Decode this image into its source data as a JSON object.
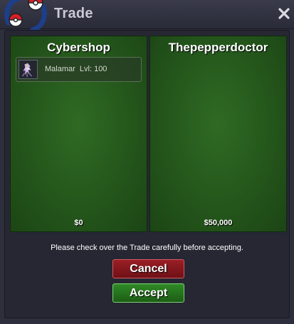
{
  "window": {
    "title": "Trade",
    "logo_icon": "pokeball-badge-icon",
    "close_icon": "close-x-icon"
  },
  "left_panel": {
    "player_name": "Cybershop",
    "money": "$0",
    "items": [
      {
        "icon": "malamar-sprite-icon",
        "label": "Malamar  Lvl: 100"
      }
    ]
  },
  "right_panel": {
    "player_name": "Thepepperdoctor",
    "money": "$50,000",
    "items": []
  },
  "notice": "Please check over the Trade carefully before accepting.",
  "buttons": {
    "cancel": "Cancel",
    "accept": "Accept"
  },
  "colors": {
    "panel_green": "#24561b",
    "cancel_red": "#8a1820",
    "accept_green": "#2a7a22",
    "window_bg": "#2e2f3c"
  }
}
